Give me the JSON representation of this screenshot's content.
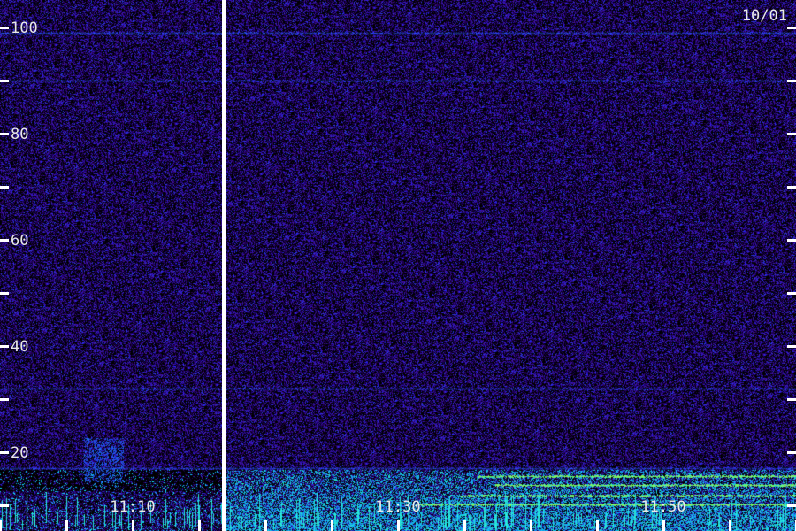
{
  "chart_data": {
    "type": "heatmap",
    "title": "",
    "date_label": "10/01",
    "xlabel": "",
    "ylabel": "",
    "y_ticks": [
      {
        "value": 10,
        "label": ""
      },
      {
        "value": 20,
        "label": "20"
      },
      {
        "value": 30,
        "label": ""
      },
      {
        "value": 40,
        "label": "40"
      },
      {
        "value": 50,
        "label": ""
      },
      {
        "value": 60,
        "label": "60"
      },
      {
        "value": 70,
        "label": ""
      },
      {
        "value": 80,
        "label": "80"
      },
      {
        "value": 90,
        "label": ""
      },
      {
        "value": 100,
        "label": "100"
      }
    ],
    "ylim": [
      5,
      105
    ],
    "x_labels": [
      {
        "time": "11:10"
      },
      {
        "time": "11:30"
      },
      {
        "time": "11:50"
      }
    ],
    "x_major_tick_minutes": 5,
    "colormap": [
      "#000000",
      "#1a0a5e",
      "#3320c0",
      "#1e6bff",
      "#1fe0d0",
      "#7cff5a",
      "#ffffff"
    ],
    "features": {
      "noise_floor": "dark blue-purple",
      "horizontal_lines_at": [
        99,
        90,
        32,
        17
      ],
      "gap_marker": "vertical white line",
      "low_frequency_bands": "bright green traces below 10 after 11:30"
    }
  }
}
